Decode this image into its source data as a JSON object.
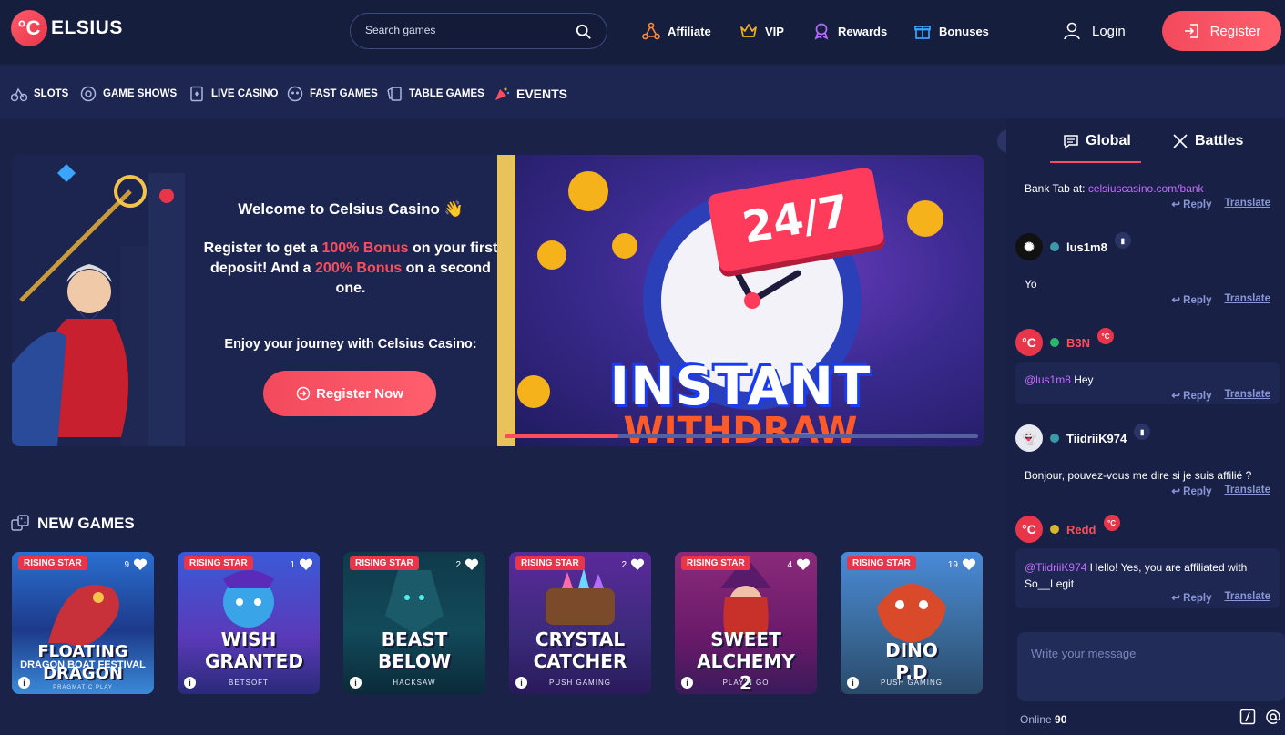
{
  "header": {
    "logo_mark": "°C",
    "logo_text": "ELSIUS",
    "search_placeholder": "Search games",
    "nav": [
      {
        "label": "Affiliate",
        "icon": "affiliate-icon"
      },
      {
        "label": "VIP",
        "icon": "crown-icon"
      },
      {
        "label": "Rewards",
        "icon": "medal-icon"
      },
      {
        "label": "Bonuses",
        "icon": "gift-icon"
      }
    ],
    "login_label": "Login",
    "register_label": "Register"
  },
  "categories": [
    {
      "label": "SLOTS",
      "icon": "slots-icon"
    },
    {
      "label": "GAME SHOWS",
      "icon": "game-shows-icon"
    },
    {
      "label": "LIVE CASINO",
      "icon": "live-casino-icon"
    },
    {
      "label": "FAST GAMES",
      "icon": "fast-games-icon"
    },
    {
      "label": "TABLE GAMES",
      "icon": "table-games-icon"
    },
    {
      "label": "EVENTS",
      "icon": "events-icon"
    }
  ],
  "hero": {
    "welcome": "Welcome to Celsius Casino 👋",
    "promo_1": "Register to get a ",
    "promo_hl1": "100% Bonus",
    "promo_2": " on your first deposit! And a ",
    "promo_hl2": "200% Bonus",
    "promo_3": " on a second one.",
    "enjoy": "Enjoy your journey with Celsius Casino:",
    "register_now": "Register Now"
  },
  "banner": {
    "badge": "24/7",
    "line1": "INSTANT",
    "line2": "WITHDRAW",
    "progress": 0.24,
    "colors": {
      "accent": "#ff4d5e"
    }
  },
  "new_games": {
    "title": "NEW GAMES",
    "items": [
      {
        "badge": "RISING STAR",
        "likes": "9",
        "title": "FLOATING DRAGON",
        "sub": "DRAGON BOAT FESTIVAL",
        "provider": "PRAGMATIC PLAY"
      },
      {
        "badge": "RISING STAR",
        "likes": "1",
        "title": "WISH GRANTED",
        "sub": "",
        "provider": "BETSOFT"
      },
      {
        "badge": "RISING STAR",
        "likes": "2",
        "title": "BEAST BELOW",
        "sub": "",
        "provider": "HACKSAW"
      },
      {
        "badge": "RISING STAR",
        "likes": "2",
        "title": "CRYSTAL CATCHER",
        "sub": "",
        "provider": "PUSH GAMING"
      },
      {
        "badge": "RISING STAR",
        "likes": "4",
        "title": "SWEET ALCHEMY 2",
        "sub": "",
        "provider": "PLAY'N GO"
      },
      {
        "badge": "RISING STAR",
        "likes": "19",
        "title": "DINO P.D",
        "sub": "",
        "provider": "PUSH GAMING"
      }
    ]
  },
  "chat": {
    "tabs": [
      "Global",
      "Battles"
    ],
    "reply_label": "Reply",
    "translate_label": "Translate",
    "msg0_text": "Bank Tab at: ",
    "msg0_link": "celsiuscasino.com/bank",
    "messages": [
      {
        "user": "lus1m8",
        "text": "Yo",
        "mention": ""
      },
      {
        "user": "B3N",
        "text": " Hey",
        "mention": "@lus1m8"
      },
      {
        "user": "TiidriiK974",
        "text": "Bonjour, pouvez-vous me dire si je suis affilié ?",
        "mention": ""
      },
      {
        "user": "Redd",
        "text": " Hello! Yes, you are affiliated with So__Legit",
        "mention": "@TiidriiK974"
      }
    ],
    "badge_celsius": "°C",
    "input_placeholder": "Write your message",
    "online_label": "Online",
    "online_count": "90"
  }
}
